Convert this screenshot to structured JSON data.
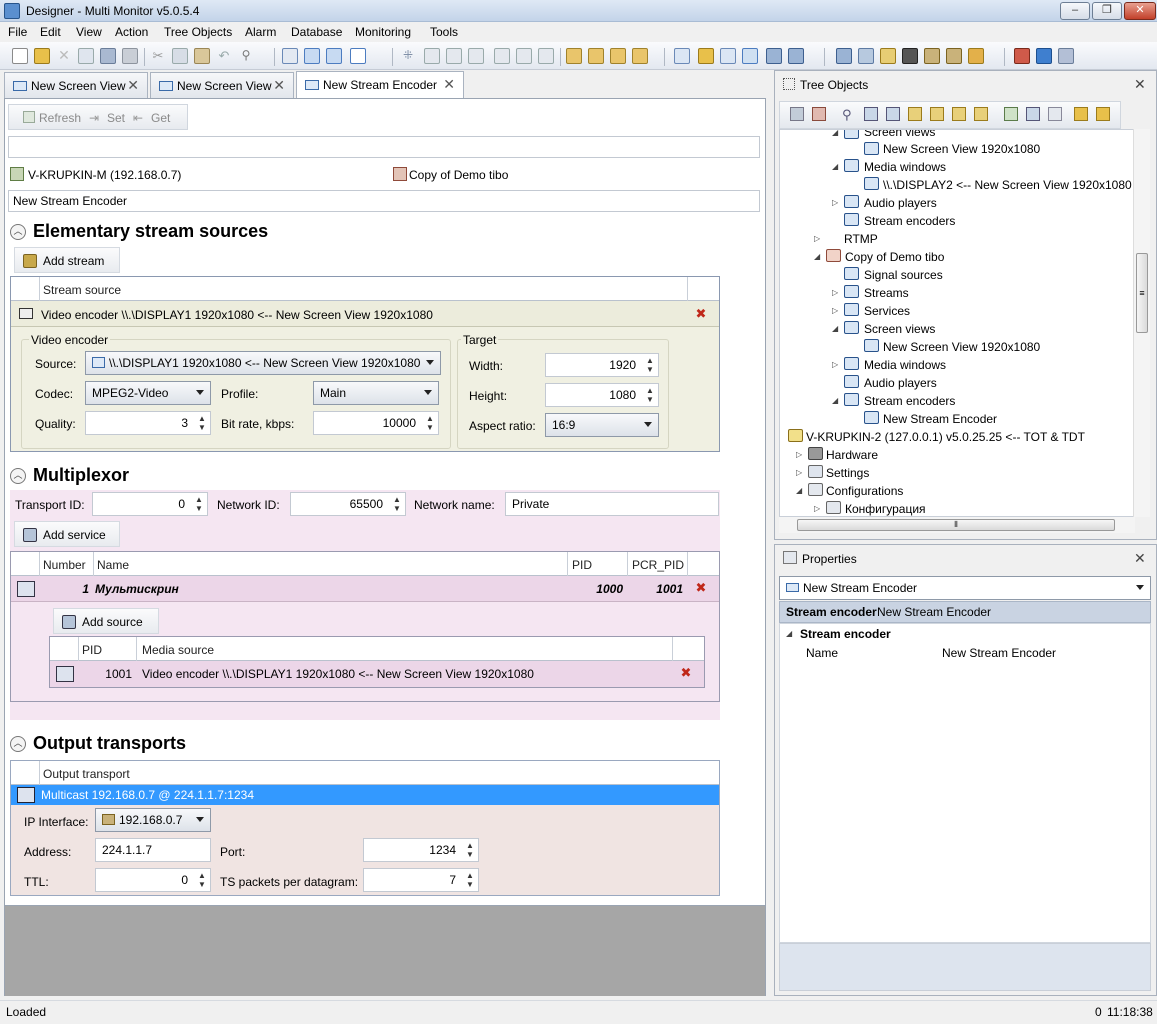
{
  "window": {
    "title": "Designer - Multi Monitor v5.0.5.4",
    "min": "–",
    "max": "❐",
    "close": "✕"
  },
  "menu": [
    "File",
    "Edit",
    "View",
    "Action",
    "Tree Objects",
    "Alarm",
    "Database",
    "Monitoring",
    "Tools"
  ],
  "tabs": [
    {
      "label": "New Screen View"
    },
    {
      "label": "New Screen View"
    },
    {
      "label": "New Stream Encoder"
    }
  ],
  "subtoolbar": {
    "refresh": "Refresh",
    "set": "Set",
    "get": "Get"
  },
  "header": {
    "host": "V-KRUPKIN-M (192.168.0.7)",
    "config": "Copy of Demo tibo",
    "name": "New Stream Encoder"
  },
  "elementary": {
    "title": "Elementary stream sources",
    "add_stream": "Add stream",
    "col_stream_source": "Stream source",
    "row": "Video encoder \\\\.\\DISPLAY1 1920x1080 <-- New Screen View 1920x1080",
    "video_encoder_group": "Video encoder",
    "target_group": "Target",
    "source_label": "Source:",
    "source_value": "\\\\.\\DISPLAY1 1920x1080 <-- New Screen View 1920x1080",
    "codec_label": "Codec:",
    "codec_value": "MPEG2-Video",
    "profile_label": "Profile:",
    "profile_value": "Main",
    "quality_label": "Quality:",
    "quality_value": "3",
    "bitrate_label": "Bit rate, kbps:",
    "bitrate_value": "10000",
    "width_label": "Width:",
    "width_value": "1920",
    "height_label": "Height:",
    "height_value": "1080",
    "aspect_label": "Aspect ratio:",
    "aspect_value": "16:9"
  },
  "multiplexor": {
    "title": "Multiplexor",
    "transport_id_label": "Transport ID:",
    "transport_id": "0",
    "network_id_label": "Network ID:",
    "network_id": "65500",
    "network_name_label": "Network name:",
    "network_name": "Private",
    "add_service": "Add service",
    "cols": {
      "number": "Number",
      "name": "Name",
      "pid": "PID",
      "pcr": "PCR_PID"
    },
    "service": {
      "number": "1",
      "name": "Мультискрин",
      "pid": "1000",
      "pcr": "1001"
    },
    "add_source": "Add source",
    "src_cols": {
      "pid": "PID",
      "media": "Media source"
    },
    "source_row": {
      "pid": "1001",
      "media": "Video encoder \\\\.\\DISPLAY1 1920x1080 <-- New Screen View 1920x1080"
    }
  },
  "output": {
    "title": "Output transports",
    "col": "Output transport",
    "row": "Multicast 192.168.0.7 @ 224.1.1.7:1234",
    "ip_iface_label": "IP Interface:",
    "ip_iface": "192.168.0.7",
    "address_label": "Address:",
    "address": "224.1.1.7",
    "port_label": "Port:",
    "port": "1234",
    "ttl_label": "TTL:",
    "ttl": "0",
    "ts_label": "TS packets per datagram:",
    "ts": "7"
  },
  "tree": {
    "title": "Tree Objects",
    "nodes": [
      "Screen views",
      "New Screen View 1920x1080",
      "Media windows",
      "\\\\.\\DISPLAY2 <-- New Screen View 1920x1080",
      "Audio players",
      "Stream encoders",
      "RTMP",
      "Copy of Demo tibo",
      "Signal sources",
      "Streams",
      "Services",
      "Screen views",
      "New Screen View 1920x1080",
      "Media windows",
      "Audio players",
      "Stream encoders",
      "New Stream Encoder",
      "V-KRUPKIN-2 (127.0.0.1) v5.0.25.25 <-- TOT & TDT",
      "Hardware",
      "Settings",
      "Configurations",
      "Конфигурация"
    ]
  },
  "properties": {
    "title": "Properties",
    "selector": "New Stream Encoder",
    "header_type": "Stream encoder",
    "header_name": "New Stream Encoder",
    "category": "Stream encoder",
    "prop_name": "Name",
    "prop_value": "New Stream Encoder"
  },
  "status": {
    "text": "Loaded",
    "count": "0",
    "time": "11:18:38"
  }
}
